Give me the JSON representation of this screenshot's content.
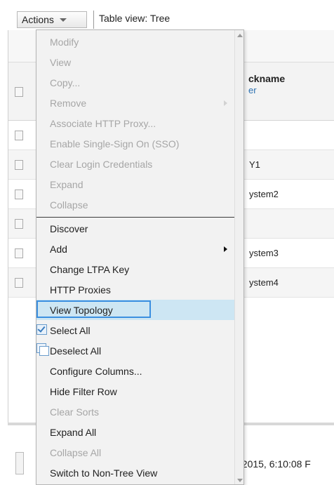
{
  "toolbar": {
    "actions_label": "Actions",
    "table_view_label": "Table view: Tree"
  },
  "background_table": {
    "header_title": "ckname",
    "header_link": "er",
    "rows": [
      "",
      "Y1",
      "ystem2",
      "",
      "ystem3",
      "ystem4"
    ],
    "status_text": ", 2015, 6:10:08 F"
  },
  "menu": {
    "items": [
      {
        "label": "Modify",
        "enabled": false
      },
      {
        "label": "View",
        "enabled": false
      },
      {
        "label": "Copy...",
        "enabled": false
      },
      {
        "label": "Remove",
        "enabled": false,
        "submenu": true
      },
      {
        "label": "Associate HTTP Proxy...",
        "enabled": false
      },
      {
        "label": "Enable Single-Sign On (SSO)",
        "enabled": false
      },
      {
        "label": "Clear Login Credentials",
        "enabled": false
      },
      {
        "label": "Expand",
        "enabled": false
      },
      {
        "label": "Collapse",
        "enabled": false
      },
      {
        "label": "Discover",
        "enabled": true
      },
      {
        "label": "Add",
        "enabled": true,
        "submenu": true
      },
      {
        "label": "Change LTPA Key",
        "enabled": true
      },
      {
        "label": "HTTP Proxies",
        "enabled": true
      },
      {
        "label": "View Topology",
        "enabled": true,
        "selected": true
      },
      {
        "label": "Select All",
        "enabled": true,
        "icon": "checkbox-checked-icon"
      },
      {
        "label": "Deselect All",
        "enabled": true,
        "icon": "checkbox-unchecked-icon"
      },
      {
        "label": "Configure Columns...",
        "enabled": true
      },
      {
        "label": "Hide Filter Row",
        "enabled": true
      },
      {
        "label": "Clear Sorts",
        "enabled": false
      },
      {
        "label": "Expand All",
        "enabled": true
      },
      {
        "label": "Collapse All",
        "enabled": false
      },
      {
        "label": "Switch to Non-Tree View",
        "enabled": true
      }
    ]
  },
  "colors": {
    "menu_background": "#f2f2f2",
    "selected_background": "#cde6f3",
    "focus_ring": "#3b8fe0",
    "disabled_text": "#a6a6a6",
    "link": "#2a6fb0"
  }
}
